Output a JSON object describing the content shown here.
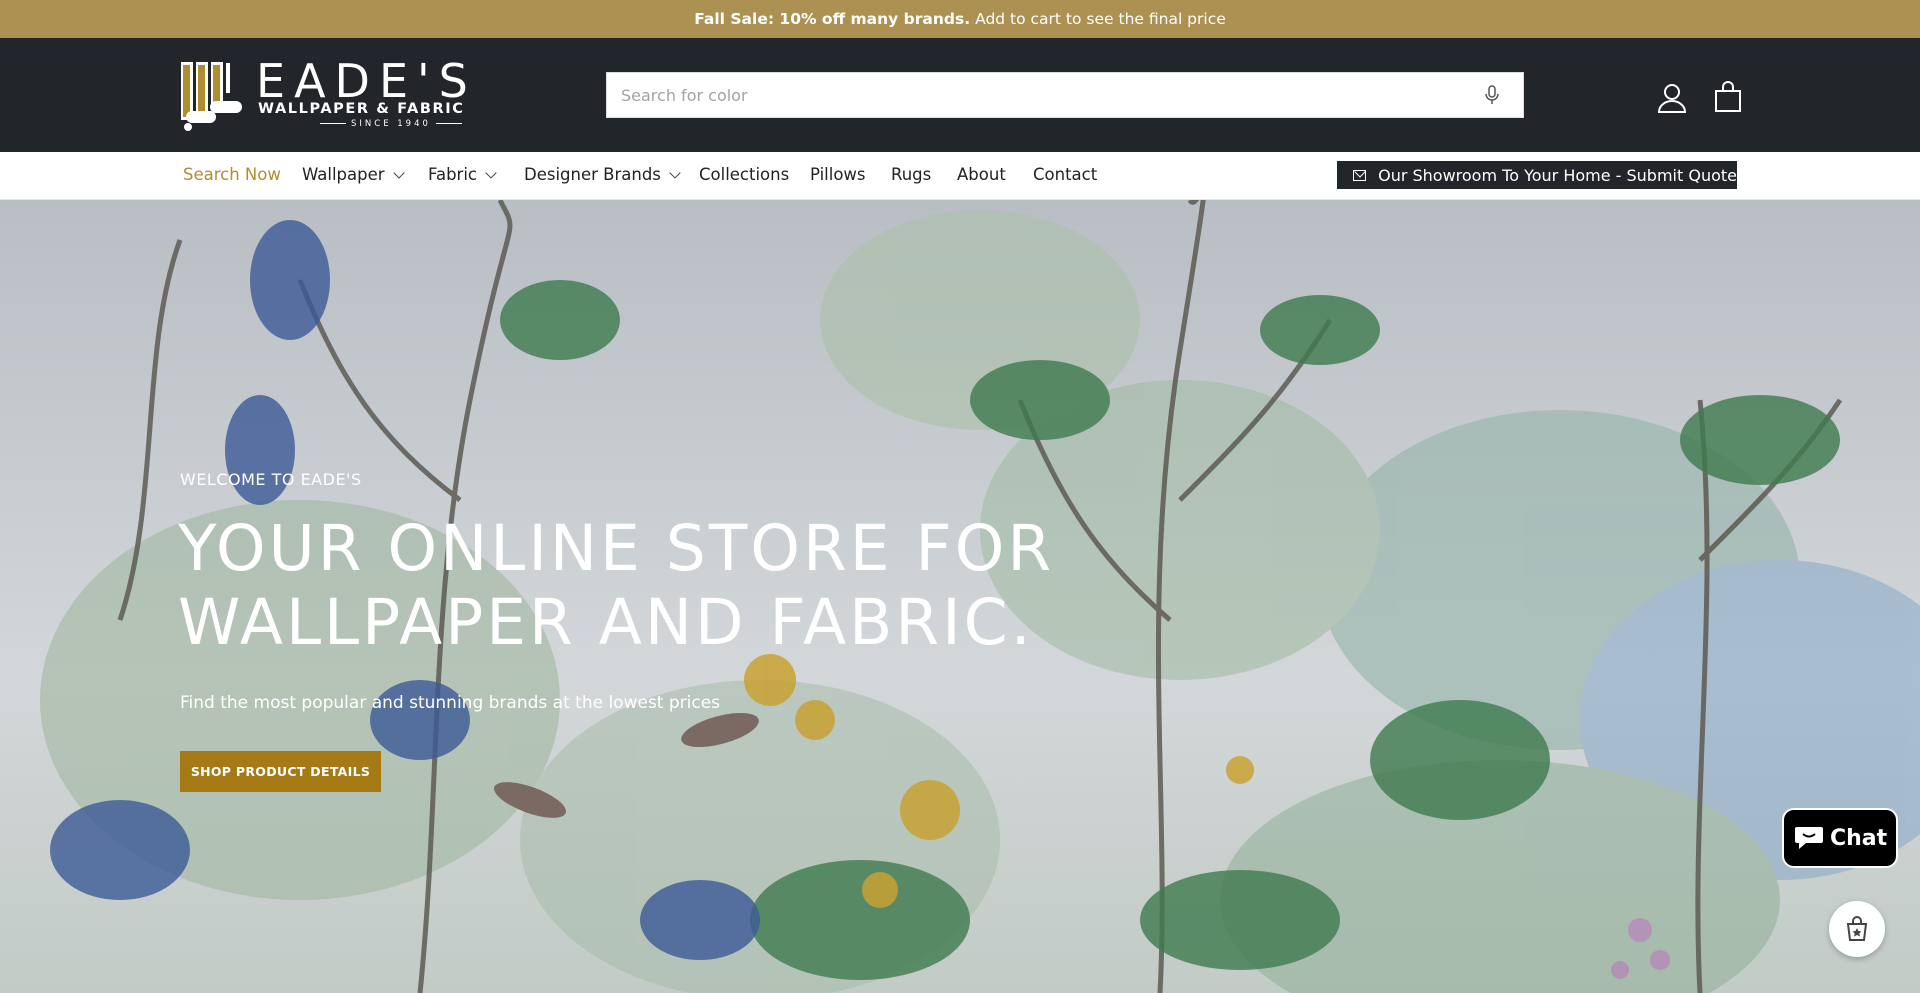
{
  "announcement": {
    "bold": "Fall Sale: 10% off many brands.",
    "text": "Add to cart to see the final price",
    "bg": "#ac9152"
  },
  "logo": {
    "word": "EADE'S",
    "sub1": "WALLPAPER & FABRIC",
    "sub2": "SINCE 1940"
  },
  "search": {
    "placeholder": "Search for color",
    "value": ""
  },
  "icons": {
    "mic": "microphone-icon",
    "account": "user-icon",
    "cart": "shopping-bag-icon",
    "quote": "envelope-icon"
  },
  "nav": {
    "items": [
      {
        "label": "Search Now",
        "active": true,
        "dropdown": false
      },
      {
        "label": "Wallpaper",
        "dropdown": true
      },
      {
        "label": "Fabric",
        "dropdown": true
      },
      {
        "label": "Designer Brands",
        "dropdown": true
      },
      {
        "label": "Collections"
      },
      {
        "label": "Pillows"
      },
      {
        "label": "Rugs"
      },
      {
        "label": "About"
      },
      {
        "label": "Contact"
      }
    ],
    "quote_button": "Our Showroom To Your Home - Submit Quote"
  },
  "hero": {
    "eyebrow": "WELCOME TO EADE'S",
    "headline_line1": "YOUR ONLINE STORE FOR",
    "headline_line2": "WALLPAPER AND FABRIC.",
    "subline": "Find the most popular and stunning brands at the lowest prices",
    "cta": "SHOP PRODUCT DETAILS"
  },
  "chat": {
    "label": "Chat"
  },
  "colors": {
    "header": "#22252a",
    "accent": "#a57a14",
    "nav_active": "#b08d2f"
  }
}
